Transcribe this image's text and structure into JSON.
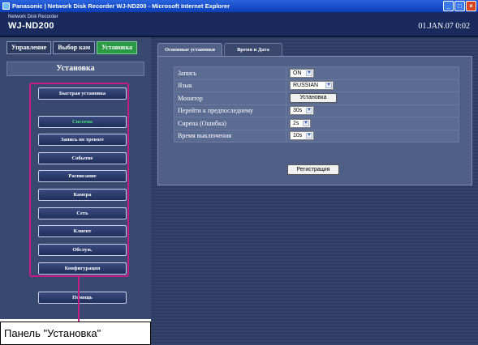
{
  "window": {
    "title": "Panasonic | Network Disk Recorder WJ-ND200 - Microsoft Internet Explorer",
    "controls": [
      "minimize-icon",
      "maximize-icon",
      "close-icon"
    ]
  },
  "header": {
    "subtitle": "Network Disk Recorder",
    "model": "WJ-ND200",
    "clock": "01.JAN.07  0:02"
  },
  "left": {
    "tabs": [
      "Управление",
      "Выбор кам",
      "Установка"
    ],
    "active_tab": "Установка",
    "title": "Установка",
    "menu": [
      {
        "label": "Быстрая установка"
      },
      {
        "label": "Система",
        "active": true
      },
      {
        "label": "Запись по тревоге"
      },
      {
        "label": "Событие"
      },
      {
        "label": "Расписание"
      },
      {
        "label": "Камера"
      },
      {
        "label": "Сеть"
      },
      {
        "label": "Клиент"
      },
      {
        "label": "Обслуж."
      },
      {
        "label": "Конфигурация"
      }
    ],
    "help": "Помощь"
  },
  "main": {
    "tabs": [
      "Основные установки",
      "Время и Дата"
    ],
    "rows": [
      {
        "label": "Запись",
        "value": "ON"
      },
      {
        "label": "Язык",
        "value": "RUSSIAN"
      },
      {
        "label": "Монитор",
        "button": "Установка"
      },
      {
        "label": "Перейти к предпоследнему",
        "value": "30s"
      },
      {
        "label": "Сирена (Ошибка)",
        "value": "2s"
      },
      {
        "label": "Время выключения",
        "value": "10s"
      }
    ],
    "register": "Регистрация"
  },
  "callout": {
    "text": "Панель \"Установка\"",
    "color": "#c21e85"
  }
}
